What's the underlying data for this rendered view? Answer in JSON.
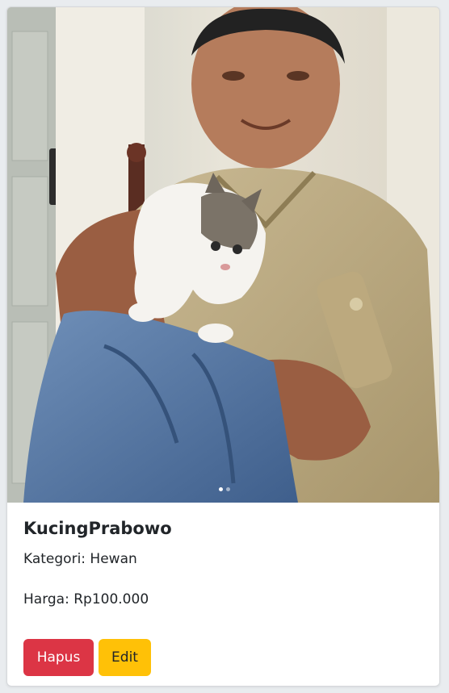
{
  "product": {
    "image_alt": "KucingPrabowo",
    "carousel": {
      "slides": 2,
      "active": 0
    },
    "name": "KucingPrabowo",
    "category_label": "Kategori: Hewan",
    "price_label": "Harga: Rp100.000"
  },
  "actions": {
    "delete_label": "Hapus",
    "edit_label": "Edit"
  },
  "colors": {
    "danger": "#dc3545",
    "warning": "#ffc107",
    "text": "#212529"
  }
}
